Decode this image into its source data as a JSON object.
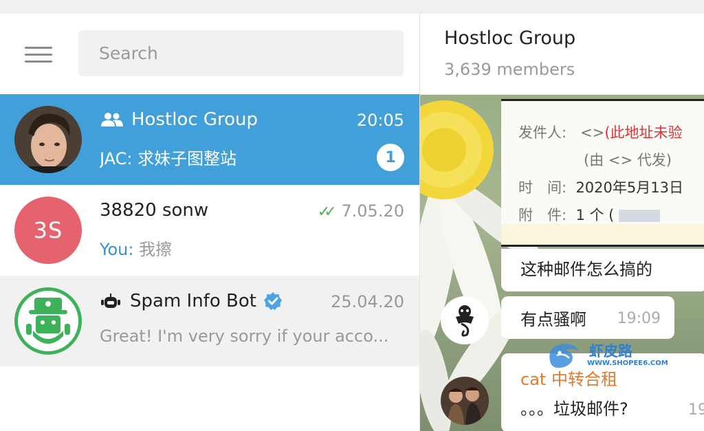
{
  "search": {
    "placeholder": "Search"
  },
  "chats": [
    {
      "title": "Hostloc Group",
      "time": "20:05",
      "preview": "JAC: 求妹子图整站",
      "unread": "1",
      "type": "group",
      "active": true
    },
    {
      "title": "38820 sonw",
      "time": "7.05.20",
      "avatar_initials": "3S",
      "avatar_color": "#e5636f",
      "preview_prefix": "You:",
      "preview": "我擦",
      "read_ticks": true
    },
    {
      "title": "Spam Info Bot",
      "time": "25.04.20",
      "preview": "Great! I'm very sorry if your acco...",
      "type": "bot",
      "verified": true
    }
  ],
  "conversation": {
    "title": "Hostloc Group",
    "members": "3,639 members",
    "email": {
      "sender_label": "发件人:",
      "sender_value": "<>",
      "sender_note": "(此地址未验",
      "on_behalf": "(由 <> 代发)",
      "time_label": "时　间:",
      "time_value": "2020年5月13日",
      "attach_label": "附　件:",
      "attach_value": "1 个 ("
    },
    "messages": [
      {
        "text": "这种邮件怎么搞的"
      },
      {
        "text": "有点骚啊",
        "time": "19:09"
      },
      {
        "sender": "cat 中转合租",
        "text": "。。。垃圾邮件?",
        "time": "19"
      }
    ]
  },
  "watermark": {
    "text": "虾皮路",
    "url": "WWW.SHOPEE6.COM"
  },
  "colors": {
    "active": "#419fd9",
    "accent_green": "#3eb25a",
    "avatar_red": "#e5636f",
    "sender": "#e07a2e"
  }
}
